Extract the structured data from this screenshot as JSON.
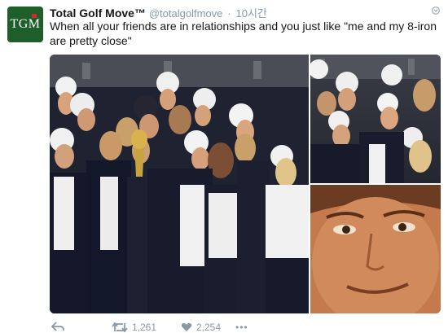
{
  "author": {
    "avatar_text": "TGM",
    "display_name": "Total Golf Move™",
    "handle": "@totalgolfmove",
    "separator": "·",
    "time": "10시간"
  },
  "tweet": {
    "text": "When all your friends are in relationships and you just like \"me and my 8-iron are pretty close\""
  },
  "actions": {
    "retweets": "1,261",
    "likes": "2,254",
    "more": "•••"
  },
  "colors": {
    "avatar_bg": "#1d5e2a",
    "muted": "#8899a6",
    "text": "#14171a"
  }
}
